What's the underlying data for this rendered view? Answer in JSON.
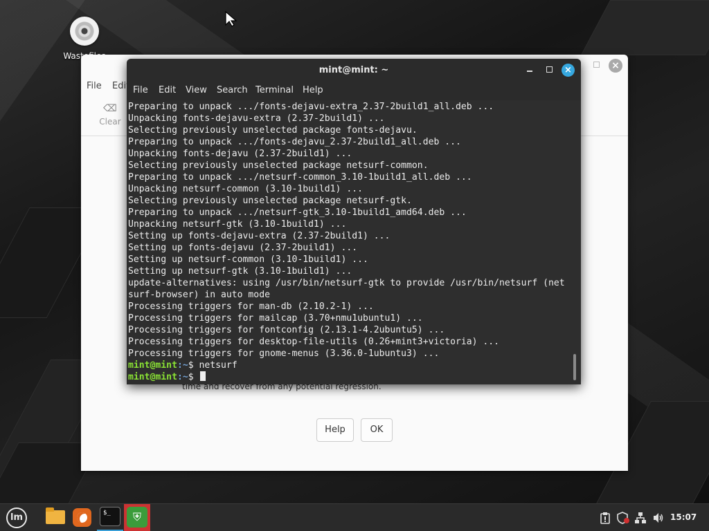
{
  "desktop": {
    "icon_label": "Wastefiles"
  },
  "background_window": {
    "menu": [
      "File",
      "Edit"
    ],
    "clear_label": "Clear",
    "body_text": "time and recover from any potential regression.",
    "help_button": "Help",
    "ok_button": "OK"
  },
  "terminal": {
    "title": "mint@mint: ~",
    "menu": [
      "File",
      "Edit",
      "View",
      "Search",
      "Terminal",
      "Help"
    ],
    "lines": [
      "Preparing to unpack .../fonts-dejavu-extra_2.37-2build1_all.deb ...",
      "Unpacking fonts-dejavu-extra (2.37-2build1) ...",
      "Selecting previously unselected package fonts-dejavu.",
      "Preparing to unpack .../fonts-dejavu_2.37-2build1_all.deb ...",
      "Unpacking fonts-dejavu (2.37-2build1) ...",
      "Selecting previously unselected package netsurf-common.",
      "Preparing to unpack .../netsurf-common_3.10-1build1_all.deb ...",
      "Unpacking netsurf-common (3.10-1build1) ...",
      "Selecting previously unselected package netsurf-gtk.",
      "Preparing to unpack .../netsurf-gtk_3.10-1build1_amd64.deb ...",
      "Unpacking netsurf-gtk (3.10-1build1) ...",
      "Setting up fonts-dejavu-extra (2.37-2build1) ...",
      "Setting up fonts-dejavu (2.37-2build1) ...",
      "Setting up netsurf-common (3.10-1build1) ...",
      "Setting up netsurf-gtk (3.10-1build1) ...",
      "update-alternatives: using /usr/bin/netsurf-gtk to provide /usr/bin/netsurf (net",
      "surf-browser) in auto mode",
      "Processing triggers for man-db (2.10.2-1) ...",
      "Processing triggers for mailcap (3.70+nmu1ubuntu1) ...",
      "Processing triggers for fontconfig (2.13.1-4.2ubuntu5) ...",
      "Processing triggers for desktop-file-utils (0.26+mint3+victoria) ...",
      "Processing triggers for gnome-menus (3.36.0-1ubuntu3) ..."
    ],
    "prompt_user": "mint@mint",
    "prompt_path": ":~",
    "prompt_symbol": "$",
    "last_command": "netsurf"
  },
  "taskbar": {
    "menu_logo": "lm",
    "terminal_icon_text": "$_",
    "clock": "15:07"
  },
  "icons": {
    "desktop_disc": "disc-icon",
    "menu": "mint-menu-icon",
    "files": "folder-icon",
    "browser": "firefox-icon",
    "terminal": "terminal-icon",
    "security": "shield-icon",
    "tray": [
      "clipboard-icon",
      "shield-tray-icon",
      "network-icon",
      "volume-icon"
    ]
  },
  "colors": {
    "terminal_close": "#36a8e0",
    "prompt_user": "#8ae234",
    "prompt_path": "#729fcf",
    "taskbar_active": "#3aa0d8",
    "shield_highlight": "#cc3333"
  }
}
